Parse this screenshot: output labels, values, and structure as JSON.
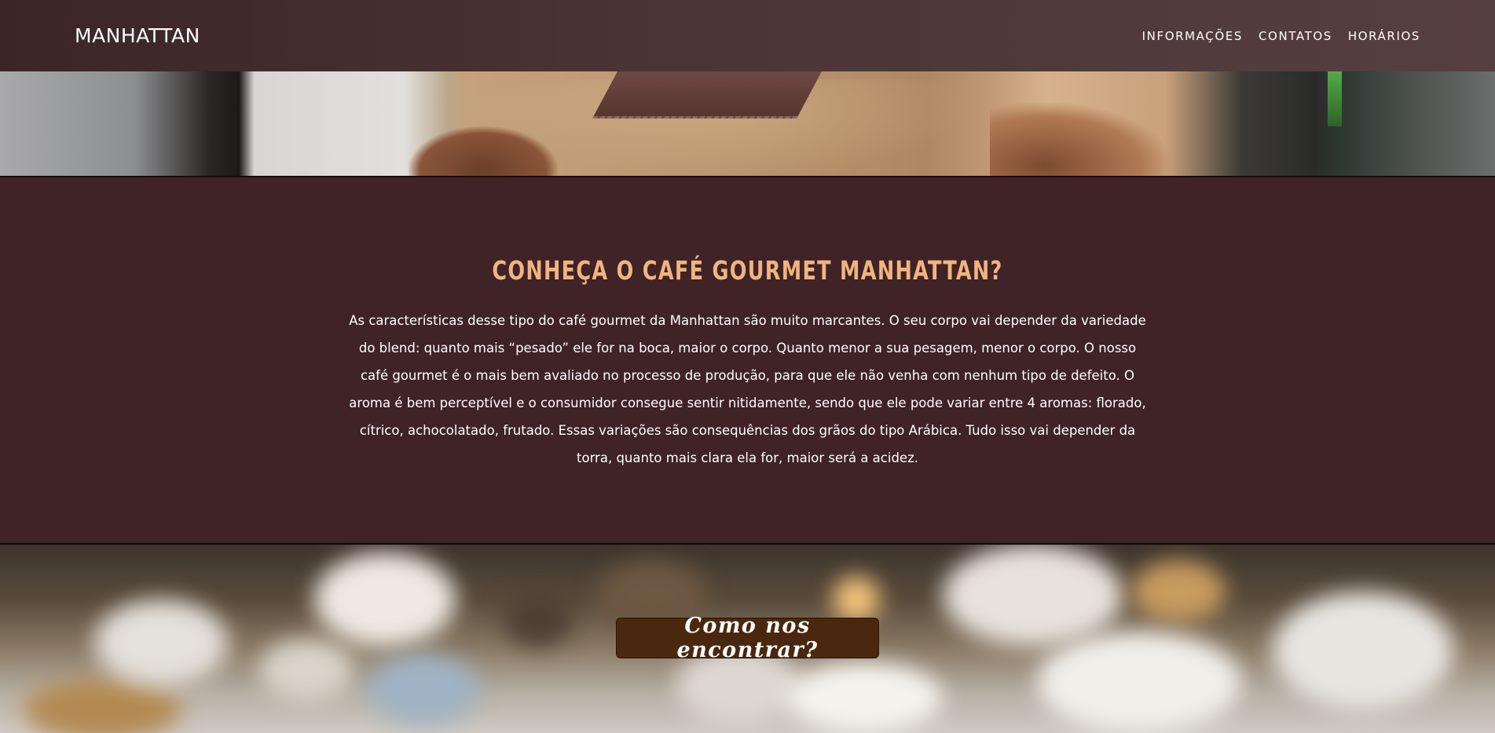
{
  "navbar": {
    "brand": "MANHATTAN",
    "links": [
      {
        "label": "INFORMAÇÕES"
      },
      {
        "label": "CONTATOS"
      },
      {
        "label": "HORÁRIOS"
      }
    ]
  },
  "intro": {
    "title": "CONHEÇA O CAFÉ GOURMET MANHATTAN?",
    "text": "As características desse tipo do café gourmet da Manhattan são muito marcantes. O seu corpo vai depender da variedade do blend: quanto mais “pesado” ele for na boca, maior o corpo. Quanto menor a sua pesagem, menor o corpo. O nosso café gourmet é o mais bem avaliado no processo de produção, para que ele não venha com nenhum tipo de defeito. O aroma é bem perceptível e o consumidor consegue sentir nitidamente, sendo que ele pode variar entre 4 aromas: florado, cítrico, achocolatado, frutado. Essas variações são consequências dos grãos do tipo Arábica. Tudo isso vai depender da torra, quanto mais clara ela for, maior será a acidez."
  },
  "cta": {
    "label": "Como nos encontrar?"
  },
  "colors": {
    "accent_title": "#f1b47f",
    "section_background": "#3f2327",
    "cta_background": "#4a270f"
  }
}
